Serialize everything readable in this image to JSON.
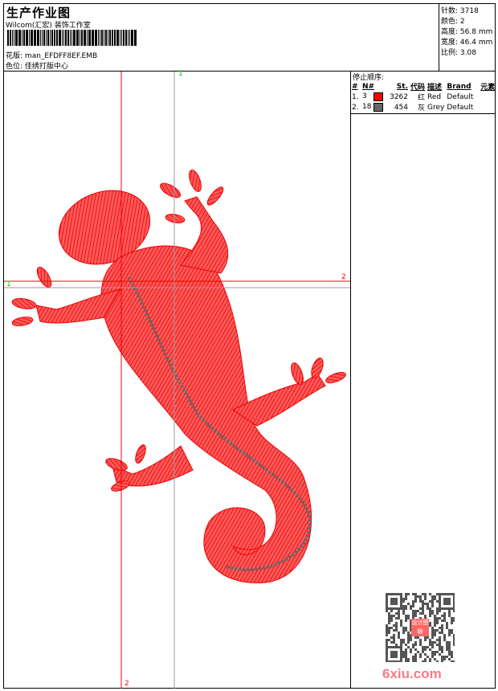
{
  "header": {
    "title": "生产作业图",
    "company": "Wilcom(汇宏) 装饰工作室",
    "design_label": "花版:",
    "design_value": "man_EFDFF8EF.EMB",
    "color_label": "色位:",
    "color_value": "佳绣打版中心"
  },
  "stats": [
    {
      "label": "针数:",
      "value": "3718"
    },
    {
      "label": "颜色:",
      "value": "2"
    },
    {
      "label": "高度:",
      "value": "56.8 mm"
    },
    {
      "label": "宽度:",
      "value": "46.4 mm"
    },
    {
      "label": "比例:",
      "value": "3.08"
    }
  ],
  "stop_sequence": {
    "title": "停止顺序:",
    "columns": [
      "#",
      "N#",
      "St.",
      "代码",
      "描述",
      "Brand",
      "元素"
    ],
    "rows": [
      {
        "idx": "1.",
        "n": "3",
        "color": "#ff0000",
        "st": "3262",
        "code": "红",
        "desc": "Red",
        "brand": "Default"
      },
      {
        "idx": "2.",
        "n": "18",
        "color": "#666666",
        "st": "454",
        "code": "灰",
        "desc": "Grey",
        "brand": "Default"
      }
    ]
  },
  "guides": {
    "v1": "1",
    "v2": "2",
    "h1": "1",
    "h2": "2"
  },
  "watermark": {
    "text": "6xiu.com",
    "stamp": "设计图版"
  },
  "colors": {
    "thread1": "#ff0000",
    "thread2": "#666666",
    "guide_red": "#ff0000",
    "guide_gray": "#999999",
    "guide_label": "#00cc00"
  }
}
